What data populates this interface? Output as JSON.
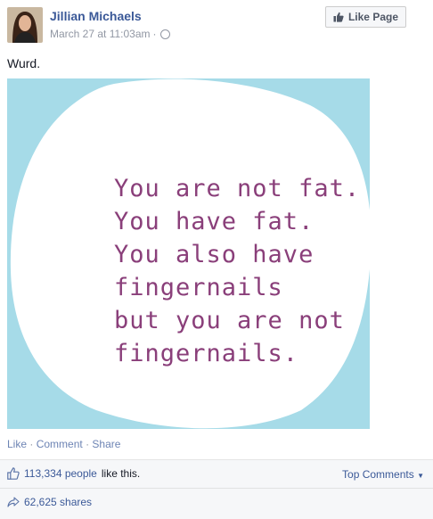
{
  "post": {
    "author": "Jillian Michaels",
    "timestamp": "March 27 at 11:03am",
    "separator": "·",
    "privacy_icon": "globe-icon",
    "text": "Wurd."
  },
  "header": {
    "like_page_label": "Like Page",
    "like_page_icon": "thumbs-up-icon"
  },
  "image": {
    "lines": [
      "You are not fat.",
      "You have fat.",
      "You also have",
      "fingernails",
      "but you are not",
      "fingernails."
    ],
    "background_color": "#a6dbe8",
    "blob_color": "#ffffff",
    "text_color": "#8a3f7a"
  },
  "actions": {
    "like": "Like",
    "comment": "Comment",
    "share": "Share",
    "sep": "·"
  },
  "feedback": {
    "likes_count": "113,334 people",
    "likes_suffix": "like this.",
    "top_comments": "Top Comments",
    "shares": "62,625 shares"
  },
  "colors": {
    "link": "#3b5998",
    "muted": "#9197a3"
  }
}
